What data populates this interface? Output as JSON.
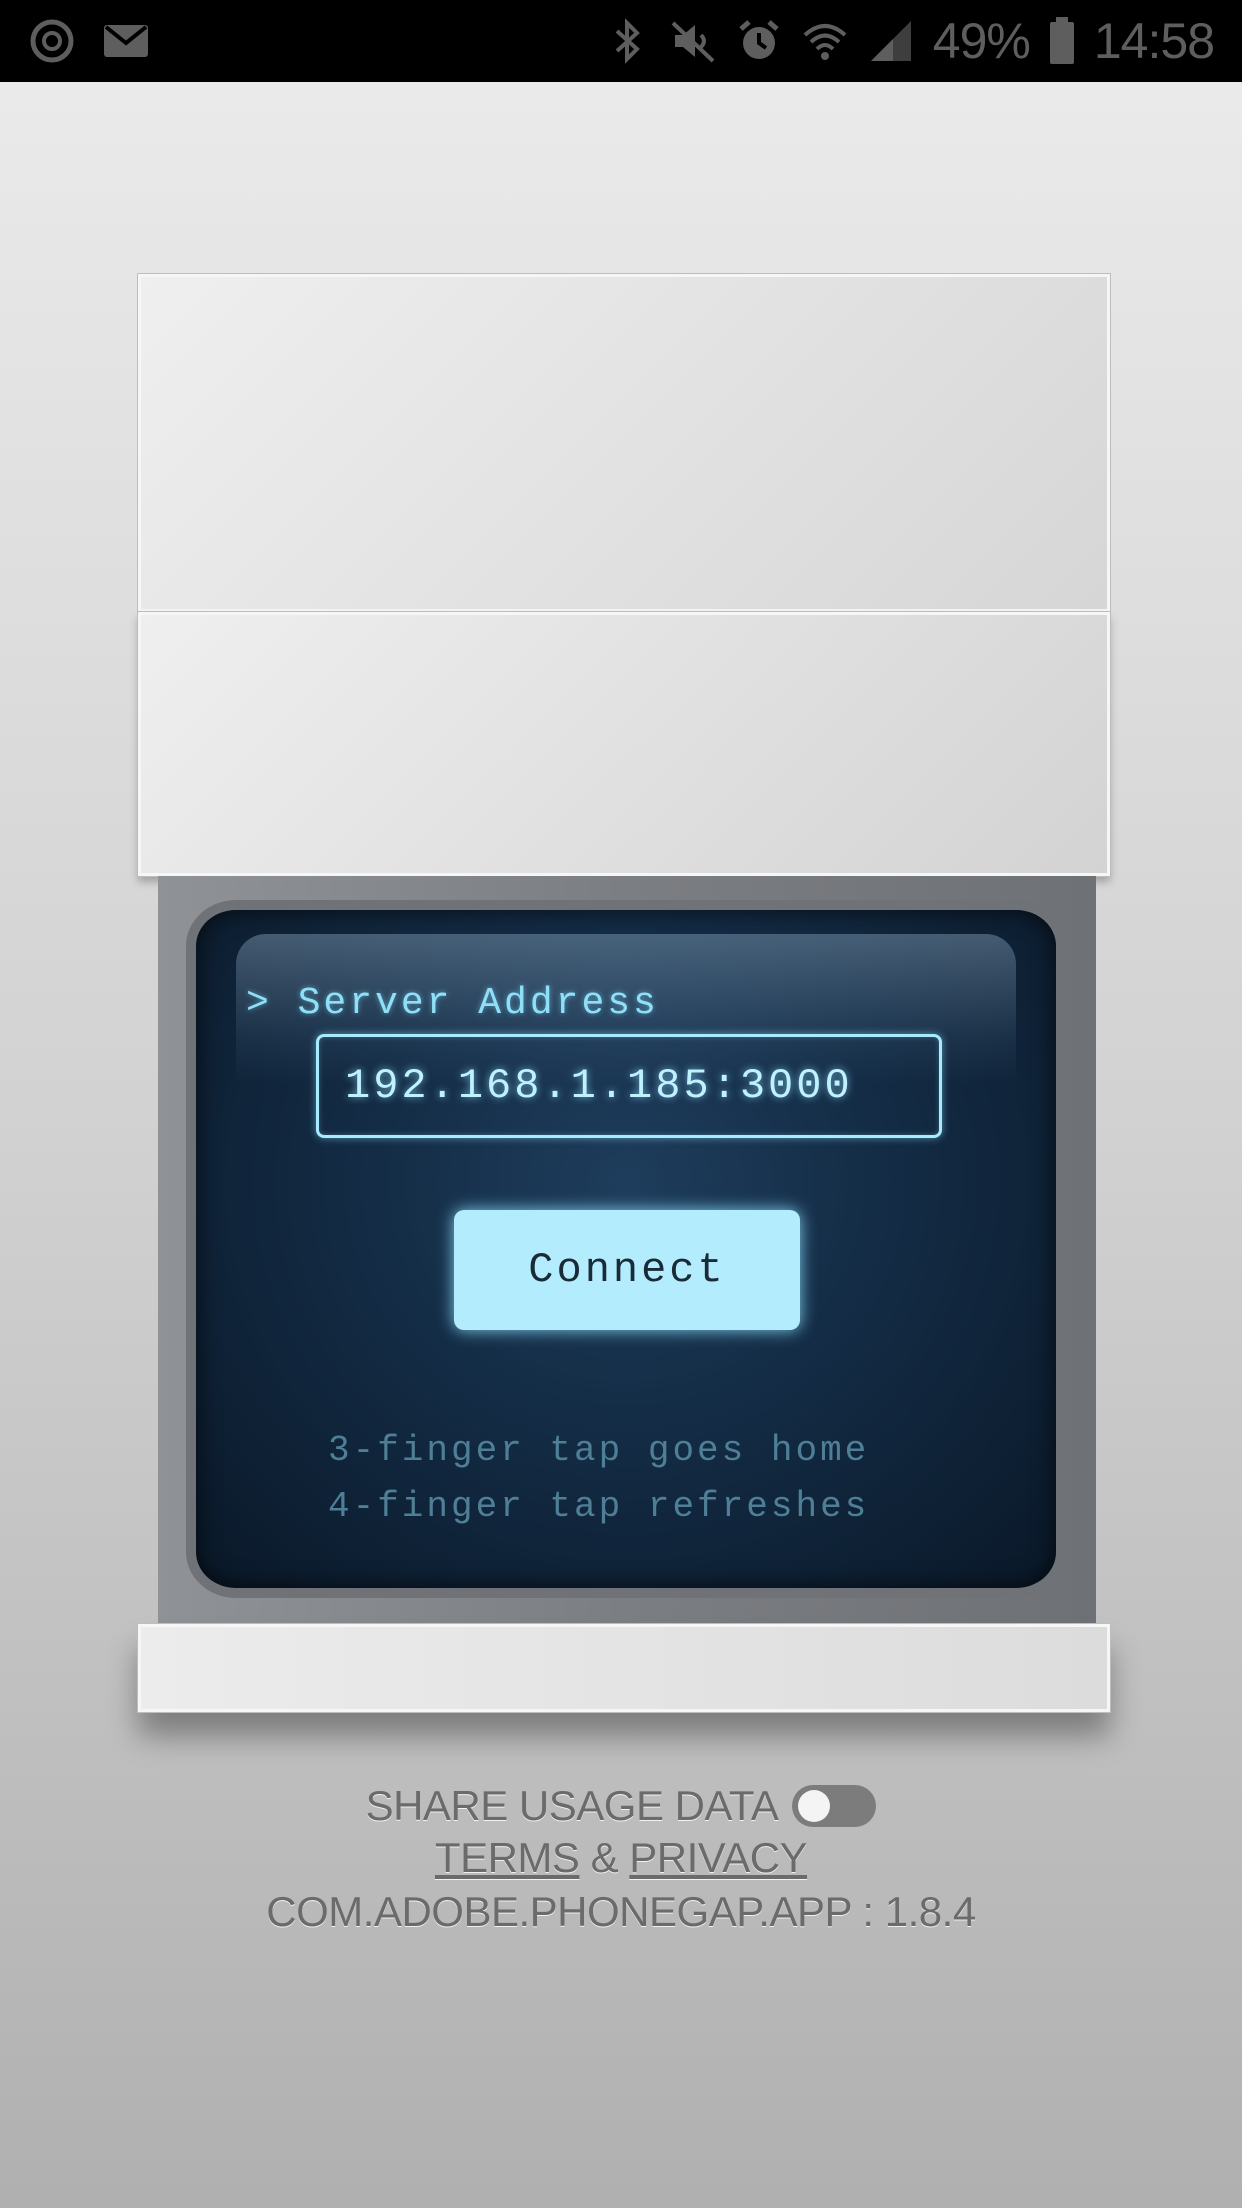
{
  "status_bar": {
    "left_icons": [
      "power-icon",
      "mail-icon"
    ],
    "right_icons": [
      "bluetooth-icon",
      "mute-icon",
      "alarm-icon",
      "wifi-icon",
      "signal-icon",
      "battery-icon"
    ],
    "battery_percent": "49%",
    "time": "14:58"
  },
  "screen": {
    "prompt_label": "> Server Address",
    "server_address": "192.168.1.185:3000",
    "connect_label": "Connect",
    "hint_home": "3-finger tap goes home",
    "hint_refresh": "4-finger tap refreshes"
  },
  "footer": {
    "share_usage_label": "SHARE USAGE DATA",
    "share_usage_enabled": false,
    "terms_label": "TERMS",
    "ampersand": "&",
    "privacy_label": "PRIVACY",
    "version_label": "COM.ADOBE.PHONEGAP.APP : 1.8.4"
  },
  "colors": {
    "accent": "#b2ecfd",
    "screen_bg": "#132b44",
    "hint_text": "#4e7f97"
  }
}
